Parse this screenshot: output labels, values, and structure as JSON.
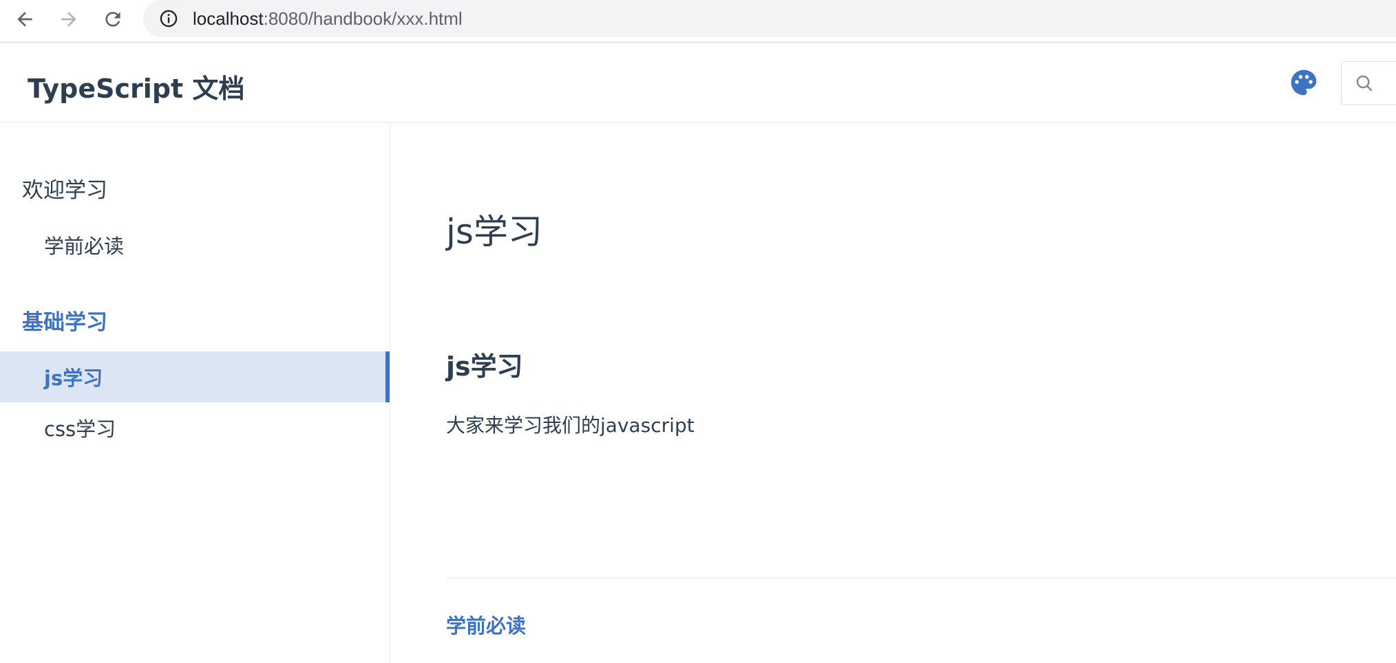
{
  "browser": {
    "url_host": "localhost",
    "url_path": ":8080/handbook/xxx.html",
    "icons": [
      "back-arrow-icon",
      "forward-arrow-icon",
      "reload-icon",
      "info-icon"
    ]
  },
  "header": {
    "site_title": "TypeScript 文档",
    "icons": [
      "palette-icon",
      "search-icon"
    ],
    "accent_color": "#3e73c4"
  },
  "sidebar": {
    "groups": [
      {
        "title": "欢迎学习",
        "active": false,
        "items": [
          {
            "label": "学前必读",
            "active": false
          }
        ]
      },
      {
        "title": "基础学习",
        "active": true,
        "items": [
          {
            "label": "js学习",
            "active": true
          },
          {
            "label": "css学习",
            "active": false
          }
        ]
      }
    ]
  },
  "main": {
    "h1": "js学习",
    "h2": "js学习",
    "paragraph": "大家来学习我们的javascript",
    "prev_link": "学前必读"
  }
}
